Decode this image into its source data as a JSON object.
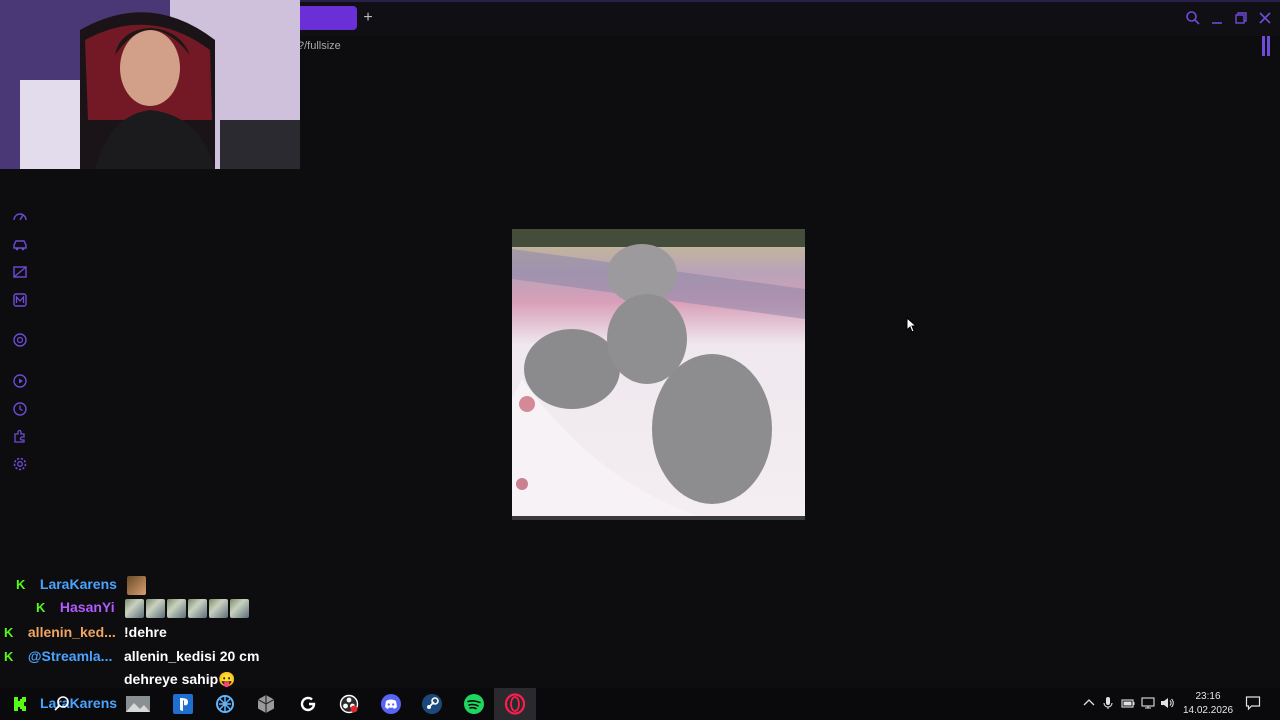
{
  "browser": {
    "new_tab_label": "+",
    "url_fragment": "?/fullsize"
  },
  "sidebar": {
    "icons": [
      "speed-dial-icon",
      "car-icon",
      "gallery-icon",
      "m-badge-icon",
      "chatgpt-icon",
      "play-icon",
      "history-icon",
      "extensions-icon",
      "settings-icon"
    ]
  },
  "chat": {
    "messages": [
      {
        "user": "LaraKarens",
        "user_color": "#4aa3ff",
        "text": "",
        "emotes": 1
      },
      {
        "user": "HasanYi",
        "user_color": "#b25cff",
        "text": "",
        "emotes": 6
      },
      {
        "user": "allenin_ked...",
        "user_color": "#f1a661",
        "text": "!dehre",
        "emotes": 0
      },
      {
        "user": "@Streamla...",
        "user_color": "#4aa3ff",
        "text": "allenin_kedisi 20 cm",
        "emotes": 0
      },
      {
        "user": "",
        "user_color": "#ffffff",
        "text": "dehreye sahip😛",
        "emotes": 0
      },
      {
        "user": "LaraKarens",
        "user_color": "#4aa3ff",
        "text": "",
        "emotes": 0
      }
    ]
  },
  "taskbar": {
    "apps": [
      "search-icon",
      "file-explorer-icon",
      "photo-icon",
      "playstation-icon",
      "network-app-icon",
      "unity-icon",
      "logitech-icon",
      "obs-icon",
      "discord-icon",
      "steam-icon",
      "spotify-icon",
      "opera-gx-icon"
    ],
    "clock_time": "23:16",
    "clock_date": "14.02.2026"
  },
  "colors": {
    "accent": "#6e4bd8",
    "kick_green": "#53fc18"
  }
}
